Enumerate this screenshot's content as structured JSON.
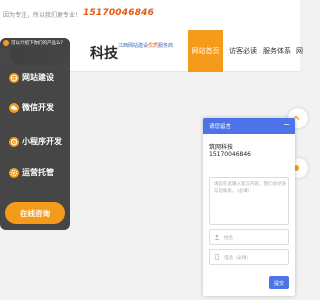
{
  "topbar": {
    "slogan": "因为专注，所以我们更专业！",
    "phone": "15170046846"
  },
  "header": {
    "logo_sub": "",
    "logo_word": "科技",
    "tagline_prefix": "江西网站建设",
    "tagline_highlight": "优质",
    "tagline_suffix": "服务商"
  },
  "nav": {
    "items": [
      "网站首页",
      "访客必读",
      "服务体系",
      "网"
    ],
    "active": "网站首页"
  },
  "float_panel": {
    "banner": "可以介绍下你们的产品么？",
    "menu": [
      {
        "label": "网站建设",
        "icon": "globe-icon"
      },
      {
        "label": "微信开发",
        "icon": "wechat-icon"
      },
      {
        "label": "小程序开发",
        "icon": "miniprogram-icon"
      },
      {
        "label": "运营托管",
        "icon": "gear-icon"
      }
    ],
    "consult": "在线咨询"
  },
  "chat": {
    "title": "请您留言",
    "minimize": "−",
    "company": "筑网科技",
    "phone": "15170046846",
    "message_placeholder": "请您在此输入留言内容，我们会尽快与您联系。（必填）",
    "name_placeholder": "姓名",
    "phone_placeholder": "电话（必填）",
    "send": "提交"
  },
  "colors": {
    "accent": "#f59b1c",
    "chat_blue": "#4c74e8",
    "phone_orange": "#e8580c"
  }
}
